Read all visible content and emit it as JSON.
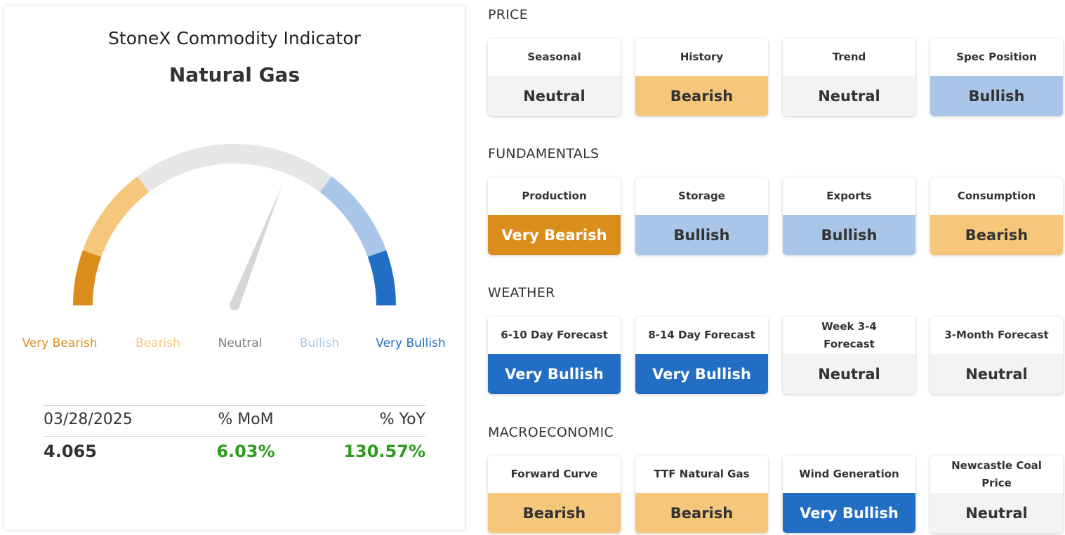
{
  "gauge": {
    "title": "StoneX Commodity Indicator",
    "commodity": "Natural Gas",
    "needle_level": 0.62,
    "scale": [
      {
        "label": "Very Bearish",
        "color": "#db8d1b"
      },
      {
        "label": "Bearish",
        "color": "#f6c77a"
      },
      {
        "label": "Neutral",
        "color": "#7a7a7a"
      },
      {
        "label": "Bullish",
        "color": "#a9c6e8"
      },
      {
        "label": "Very Bullish",
        "color": "#226ec4"
      }
    ],
    "neutral_arc_color": "#e5e7e6",
    "needle_color": "#d4d7d6"
  },
  "stats": {
    "headers": [
      "03/28/2025",
      "% MoM",
      "% YoY"
    ],
    "values": [
      "4.065",
      "6.03%",
      "130.57%"
    ],
    "positive_color": "#2e9a1e"
  },
  "sections": [
    {
      "title": "PRICE",
      "items": [
        {
          "label": "Seasonal",
          "value": "Neutral"
        },
        {
          "label": "History",
          "value": "Bearish"
        },
        {
          "label": "Trend",
          "value": "Neutral"
        },
        {
          "label": "Spec Position",
          "value": "Bullish"
        }
      ]
    },
    {
      "title": "FUNDAMENTALS",
      "items": [
        {
          "label": "Production",
          "value": "Very Bearish"
        },
        {
          "label": "Storage",
          "value": "Bullish"
        },
        {
          "label": "Exports",
          "value": "Bullish"
        },
        {
          "label": "Consumption",
          "value": "Bearish"
        }
      ]
    },
    {
      "title": "WEATHER",
      "items": [
        {
          "label": "6-10 Day Forecast",
          "value": "Very Bullish"
        },
        {
          "label": "8-14 Day Forecast",
          "value": "Very Bullish"
        },
        {
          "label": "Week 3-4 Forecast",
          "value": "Neutral"
        },
        {
          "label": "3-Month Forecast",
          "value": "Neutral"
        }
      ]
    },
    {
      "title": "MACROECONOMIC",
      "items": [
        {
          "label": "Forward Curve",
          "value": "Bearish"
        },
        {
          "label": "TTF Natural Gas",
          "value": "Bearish"
        },
        {
          "label": "Wind Generation",
          "value": "Very Bullish"
        },
        {
          "label": "Newcastle Coal Price",
          "value": "Neutral"
        }
      ]
    }
  ]
}
